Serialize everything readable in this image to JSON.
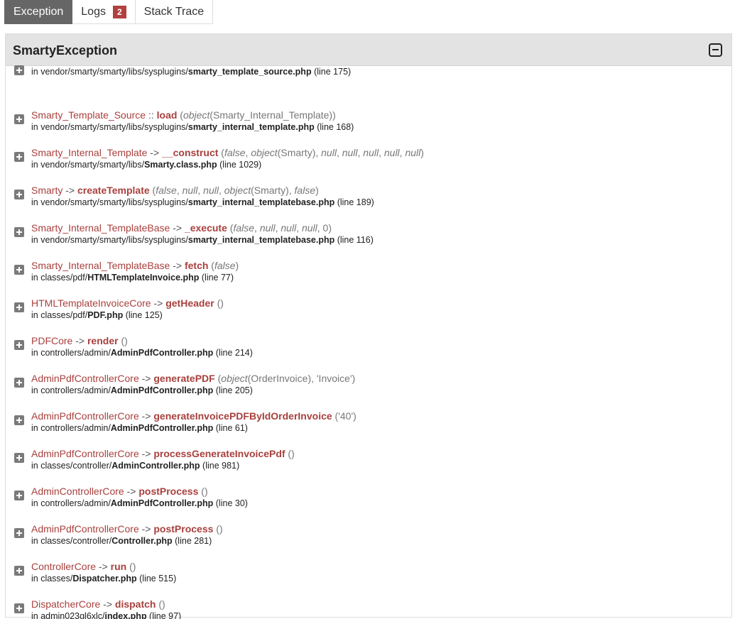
{
  "tabs": [
    {
      "label": "Exception",
      "active": true
    },
    {
      "label": "Logs",
      "badge": "2"
    },
    {
      "label": "Stack Trace"
    }
  ],
  "panel": {
    "title": "SmartyException"
  },
  "trace": [
    {
      "cls": "",
      "op": "",
      "fn": "",
      "args": "",
      "dir": "in vendor/smarty/smarty/libs/sysplugins/",
      "file": "smarty_template_source.php",
      "line": "(line 175)"
    },
    {
      "cls": "Smarty_Template_Source",
      "op": "::",
      "fn": "load",
      "args": "(<i>object</i>(Smarty_Internal_Template))",
      "dir": "in vendor/smarty/smarty/libs/sysplugins/",
      "file": "smarty_internal_template.php",
      "line": "(line 168)"
    },
    {
      "cls": "Smarty_Internal_Template",
      "op": "->",
      "fn": "__construct",
      "args": "(<i>false</i>, <i>object</i>(Smarty), <i>null</i>, <i>null</i>, <i>null</i>, <i>null</i>, <i>null</i>)",
      "dir": "in vendor/smarty/smarty/libs/",
      "file": "Smarty.class.php",
      "line": "(line 1029)"
    },
    {
      "cls": "Smarty",
      "op": "->",
      "fn": "createTemplate",
      "args": "(<i>false</i>, <i>null</i>, <i>null</i>, <i>object</i>(Smarty), <i>false</i>)",
      "dir": "in vendor/smarty/smarty/libs/sysplugins/",
      "file": "smarty_internal_templatebase.php",
      "line": "(line 189)"
    },
    {
      "cls": "Smarty_Internal_TemplateBase",
      "op": "->",
      "fn": "_execute",
      "args": "(<i>false</i>, <i>null</i>, <i>null</i>, <i>null</i>, 0)",
      "dir": "in vendor/smarty/smarty/libs/sysplugins/",
      "file": "smarty_internal_templatebase.php",
      "line": "(line 116)"
    },
    {
      "cls": "Smarty_Internal_TemplateBase",
      "op": "->",
      "fn": "fetch",
      "args": "(<i>false</i>)",
      "dir": "in classes/pdf/",
      "file": "HTMLTemplateInvoice.php",
      "line": "(line 77)"
    },
    {
      "cls": "HTMLTemplateInvoiceCore",
      "op": "->",
      "fn": "getHeader",
      "args": "()",
      "dir": "in classes/pdf/",
      "file": "PDF.php",
      "line": "(line 125)"
    },
    {
      "cls": "PDFCore",
      "op": "->",
      "fn": "render",
      "args": "()",
      "dir": "in controllers/admin/",
      "file": "AdminPdfController.php",
      "line": "(line 214)"
    },
    {
      "cls": "AdminPdfControllerCore",
      "op": "->",
      "fn": "generatePDF",
      "args": "(<i>object</i>(OrderInvoice), 'Invoice')",
      "dir": "in controllers/admin/",
      "file": "AdminPdfController.php",
      "line": "(line 205)"
    },
    {
      "cls": "AdminPdfControllerCore",
      "op": "->",
      "fn": "generateInvoicePDFByIdOrderInvoice",
      "args": "('40')",
      "dir": "in controllers/admin/",
      "file": "AdminPdfController.php",
      "line": "(line 61)"
    },
    {
      "cls": "AdminPdfControllerCore",
      "op": "->",
      "fn": "processGenerateInvoicePdf",
      "args": "()",
      "dir": "in classes/controller/",
      "file": "AdminController.php",
      "line": "(line 981)"
    },
    {
      "cls": "AdminControllerCore",
      "op": "->",
      "fn": "postProcess",
      "args": "()",
      "dir": "in controllers/admin/",
      "file": "AdminPdfController.php",
      "line": "(line 30)"
    },
    {
      "cls": "AdminPdfControllerCore",
      "op": "->",
      "fn": "postProcess",
      "args": "()",
      "dir": "in classes/controller/",
      "file": "Controller.php",
      "line": "(line 281)"
    },
    {
      "cls": "ControllerCore",
      "op": "->",
      "fn": "run",
      "args": "()",
      "dir": "in classes/",
      "file": "Dispatcher.php",
      "line": "(line 515)"
    },
    {
      "cls": "DispatcherCore",
      "op": "->",
      "fn": "dispatch",
      "args": "()",
      "dir": "in admin023gl6xlc/",
      "file": "index.php",
      "line": "(line 97)"
    }
  ]
}
